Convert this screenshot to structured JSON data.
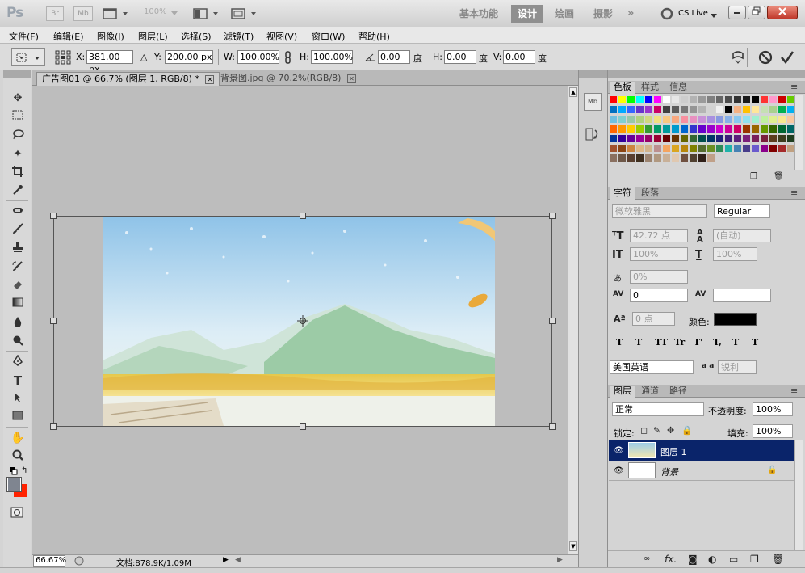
{
  "title_bar": {
    "logo": "Ps",
    "br_label": "Br",
    "mb_label": "Mb",
    "zoom": "100%",
    "workspaces": [
      "基本功能",
      "设计",
      "绘画",
      "摄影",
      "»"
    ],
    "cs_live": "CS Live"
  },
  "menu": [
    "文件(F)",
    "编辑(E)",
    "图像(I)",
    "图层(L)",
    "选择(S)",
    "滤镜(T)",
    "视图(V)",
    "窗口(W)",
    "帮助(H)"
  ],
  "options": {
    "x_label": "X:",
    "x_value": "381.00 px",
    "y_label": "Y:",
    "y_value": "200.00 px",
    "w_label": "W:",
    "w_value": "100.00%",
    "h_label": "H:",
    "h_value": "100.00%",
    "rot_value": "0.00",
    "deg": "度",
    "hskew_label": "H:",
    "hskew_value": "0.00",
    "vskew_label": "V:",
    "vskew_value": "0.00"
  },
  "doc_tabs": [
    {
      "label": "广告图01 @ 66.7% (图层 1, RGB/8) *",
      "active": true
    },
    {
      "label": "背景图.jpg @ 70.2%(RGB/8)",
      "active": false
    }
  ],
  "status": {
    "zoom": "66.67%",
    "doc_info": "文档:878.9K/1.09M"
  },
  "swatches_panel": {
    "tabs": [
      "色板",
      "样式",
      "信息"
    ]
  },
  "character_panel": {
    "tabs": [
      "字符",
      "段落"
    ],
    "font_family": "微软雅黑",
    "font_style": "Regular",
    "font_size": "42.72 点",
    "leading": "(自动)",
    "vscale": "100%",
    "hscale": "100%",
    "tsume": "0%",
    "kerning": "0",
    "baseline": "0 点",
    "color_label": "颜色:",
    "language": "美国英语",
    "antialias_icon": "a a",
    "antialias": "锐利",
    "style_buttons": [
      "T",
      "T",
      "TT",
      "Tr",
      "T'",
      "T,",
      "T",
      "T"
    ]
  },
  "layers_panel": {
    "tabs": [
      "图层",
      "通道",
      "路径"
    ],
    "blend_mode": "正常",
    "opacity_label": "不透明度:",
    "opacity": "100%",
    "lock_label": "锁定:",
    "fill_label": "填充:",
    "fill": "100%",
    "layers": [
      {
        "name": "图层 1",
        "selected": true
      },
      {
        "name": "背景",
        "selected": false,
        "locked": true
      }
    ]
  },
  "colors": {
    "foreground": "#7f8590",
    "background": "#ff2200",
    "selection": "#0a246a"
  },
  "swatch_rows": [
    [
      "#ff0000",
      "#ffff00",
      "#00ff00",
      "#00ffff",
      "#0000ff",
      "#ff00ff",
      "#ffffff",
      "#e6e6e6",
      "#cdcdcd",
      "#b3b3b3",
      "#9a9a9a",
      "#808080",
      "#666666",
      "#4d4d4d",
      "#333333",
      "#1a1a1a",
      "#000000",
      "#ff3333",
      "#ff99cc",
      "#cc0000",
      "#66cc00"
    ],
    [
      "#0070c0",
      "#00aaff",
      "#3366ff",
      "#6633cc",
      "#9933cc",
      "#cc0066",
      "#404040",
      "#5a5a5a",
      "#777777",
      "#959595",
      "#b4b4b4",
      "#d2d2d2",
      "#f0f0f0",
      "#000000",
      "#f4b183",
      "#ffc000",
      "#ffe699",
      "#c6e0b4",
      "#a9d08e",
      "#00b050",
      "#00b0f0"
    ],
    [
      "#70c0e0",
      "#80d0d0",
      "#98c8a8",
      "#b0d080",
      "#d0d880",
      "#f0e080",
      "#f8c880",
      "#f8a880",
      "#f890a0",
      "#e890c0",
      "#c890d8",
      "#a890e0",
      "#8898e0",
      "#88b0e8",
      "#88c8f0",
      "#90e0f0",
      "#a0f0d0",
      "#c0f0a0",
      "#e0f090",
      "#f8e890",
      "#f8c8a0"
    ],
    [
      "#ff6600",
      "#ff9900",
      "#ffcc00",
      "#99cc00",
      "#339933",
      "#009966",
      "#009999",
      "#0099cc",
      "#0066cc",
      "#3333cc",
      "#6600cc",
      "#9900cc",
      "#cc00cc",
      "#cc0099",
      "#cc0066",
      "#993300",
      "#996600",
      "#669900",
      "#336600",
      "#006633",
      "#006666"
    ],
    [
      "#003399",
      "#330099",
      "#660099",
      "#990099",
      "#990066",
      "#990033",
      "#660000",
      "#663300",
      "#666600",
      "#336633",
      "#004d4d",
      "#003366",
      "#1f1f7a",
      "#3d1f7a",
      "#5c1f7a",
      "#7a1f7a",
      "#7a1f5c",
      "#7a1f3d",
      "#5c3d1f",
      "#3d3d1f",
      "#1f3d1f"
    ],
    [
      "#a0522d",
      "#8b4513",
      "#cd853f",
      "#deb887",
      "#d2b48c",
      "#bc8f8f",
      "#f4a460",
      "#daa520",
      "#b8860b",
      "#808000",
      "#556b2f",
      "#6b8e23",
      "#2e8b57",
      "#20b2aa",
      "#4682b4",
      "#483d8b",
      "#6a5acd",
      "#8b008b",
      "#800000",
      "#a52a2a",
      "#c0a080"
    ],
    [
      "#8a7060",
      "#6e5848",
      "#5a4030",
      "#403020",
      "#9c8470",
      "#b09880",
      "#c8b098",
      "#e0c8b0",
      "#705040",
      "#504030",
      "#302018",
      "#c0a088"
    ]
  ]
}
